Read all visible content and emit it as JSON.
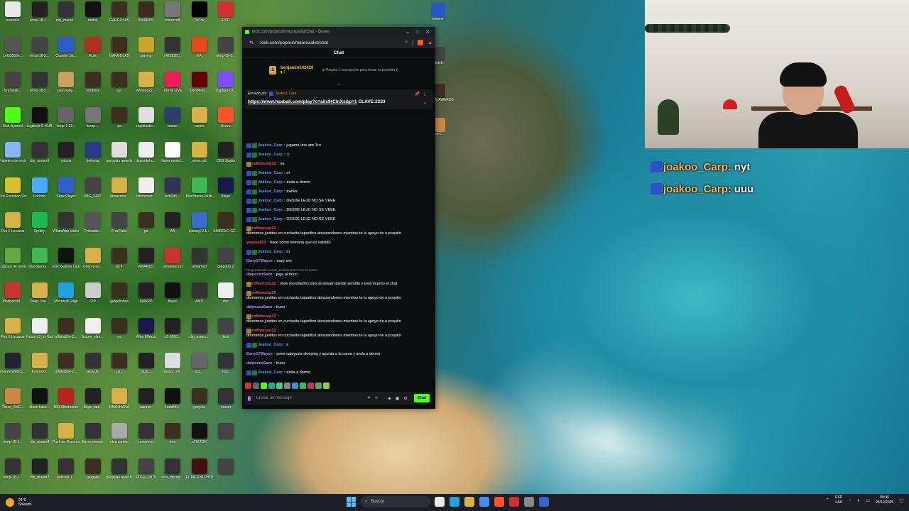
{
  "browser": {
    "title": "kick.com/popout/mauroxakd/chat - Brave",
    "url": "kick.com/popout/mauroxakd/chat"
  },
  "chat": {
    "header": "Chat",
    "gifter": {
      "name": "benjamin142420",
      "count": "1",
      "message": "Regala 1 suscripción para tomar la posición 2"
    },
    "pinned": {
      "label": "Enviado por",
      "user": "Joakoo_Carp",
      "link": "https://www.haxball.com/play?c=aiIx9rCInXs&p=1",
      "clave": "CLAVE:2233"
    },
    "messages": [
      {
        "user": "Joakoo_Carp",
        "text": "jugame uno ami 1ro",
        "color": "#4f9cff",
        "badges": [
          "#2d52c8",
          "#1f7a3a"
        ]
      },
      {
        "user": "Joakoo_Carp",
        "text": ":c",
        "color": "#4f9cff",
        "badges": [
          "#2d52c8",
          "#1f7a3a"
        ]
      },
      {
        "user": "rolfoncorp12",
        "text": "na",
        "color": "#ff4f6d",
        "badges": [
          "#a08a1f"
        ]
      },
      {
        "user": "Joakoo_Carp",
        "text": "nt",
        "color": "#4f9cff",
        "badges": [
          "#2d52c8",
          "#1f7a3a"
        ]
      },
      {
        "user": "Joakoo_Carp",
        "text": "anda a dormir",
        "color": "#4f9cff",
        "badges": [
          "#2d52c8",
          "#1f7a3a"
        ]
      },
      {
        "user": "Joakoo_Carp",
        "text": "tranka",
        "color": "#4f9cff",
        "badges": [
          "#2d52c8",
          "#1f7a3a"
        ]
      },
      {
        "user": "Joakoo_Carp",
        "text": "DESDE LEJO NO SE VEEE",
        "color": "#4f9cff",
        "badges": [
          "#2d52c8",
          "#1f7a3a"
        ]
      },
      {
        "user": "Joakoo_Carp",
        "text": "DESDE LEJO NO SE VEEE",
        "color": "#4f9cff",
        "badges": [
          "#2d52c8",
          "#1f7a3a"
        ]
      },
      {
        "user": "Joakoo_Carp",
        "text": "DESDE LEJO NO SE VEEE",
        "color": "#4f9cff",
        "badges": [
          "#2d52c8",
          "#1f7a3a"
        ]
      },
      {
        "user": "rolfoncorp12",
        "text": "dormimos juntitos en cucharita tapaditos abrazandonos mientras te la apoyo de a poquito",
        "color": "#ff4f6d",
        "badges": [
          "#a08a1f"
        ]
      },
      {
        "user": "yeyeyyll01",
        "text": "hace como     semana que es sabado",
        "color": "#ff4f6d",
        "badges": []
      },
      {
        "user": "Joakoo_Carp",
        "text": "nt",
        "color": "#4f9cff",
        "badges": [
          "#2d52c8",
          "#1f7a3a"
        ]
      },
      {
        "user": "Dany17Wayss",
        "text": "easy win",
        "color": "#b388ff",
        "badges": []
      },
      {
        "user": "dalpozzoSanz",
        "text": "juga al truco",
        "color": "#b388ff",
        "badges": [],
        "reply": "Respondiendo a God_studioCARP: hace el sorteo"
      },
      {
        "user": "rolfoncorp12",
        "text": "viste morcilla/hin bots el stream pierde sentido y está muerto el chat",
        "color": "#ff4f6d",
        "badges": [
          "#a08a1f"
        ]
      },
      {
        "user": "rolfoncorp12",
        "text": "dormimos juntitos en cucharita tapaditos abrazandonos mientras te la apoyo de a poquito",
        "color": "#ff4f6d",
        "badges": [
          "#a08a1f"
        ]
      },
      {
        "user": "dalpozzoSanz",
        "text": "truco",
        "color": "#b388ff",
        "badges": []
      },
      {
        "user": "rolfoncorp12",
        "text": "dormimos juntitos en cucharita tapaditos abrazandonos mientras te la apoyo de a poquito",
        "color": "#ff4f6d",
        "badges": [
          "#a08a1f"
        ]
      },
      {
        "user": "rolfoncorp12",
        "text": "dormimos juntitos en cucharita tapaditos abrazandonos mientras te la apoyo de a poquito",
        "color": "#ff4f6d",
        "badges": [
          "#a08a1f"
        ]
      },
      {
        "user": "Joakoo_Carp",
        "text": "e",
        "color": "#4f9cff",
        "badges": [
          "#2d52c8",
          "#1f7a3a"
        ]
      },
      {
        "user": "Dany17Wayss",
        "text": "pone categoria sleeping y apunta a la cama y anda a dormir",
        "color": "#b388ff",
        "badges": []
      },
      {
        "user": "dalpozzoSanz",
        "text": "truco",
        "color": "#b388ff",
        "badges": []
      },
      {
        "user": "Joakoo_Carp",
        "text": "anda a dormir",
        "color": "#4f9cff",
        "badges": [
          "#2d52c8",
          "#1f7a3a"
        ]
      },
      {
        "user": "Joakoo_Carp",
        "text": "nyt",
        "color": "#4f9cff",
        "badges": [
          "#2d52c8",
          "#1f7a3a"
        ]
      },
      {
        "user": "Joakoo_Carp",
        "text": "uuu",
        "color": "#4f9cff",
        "badges": [
          "#2d52c8",
          "#1f7a3a"
        ]
      }
    ],
    "input_placeholder": "Enviar un mensaje",
    "send_label": "Chat"
  },
  "overlay": [
    {
      "user": "joakoo_Carp",
      "text": "nyt"
    },
    {
      "user": "joakoo_Carp",
      "text": "uuu"
    }
  ],
  "desktop_icons": [
    {
      "label": "meneillu",
      "color": "#e8e8e8"
    },
    {
      "label": "temp-18-1...",
      "color": "#222"
    },
    {
      "label": "clip_mauro...",
      "color": "#333"
    },
    {
      "label": "roblox",
      "color": "#111"
    },
    {
      "label": "GARGOLAS",
      "color": "#3b3020"
    },
    {
      "label": "AWARDS",
      "color": "#3a2d1a"
    },
    {
      "label": "minecraft",
      "color": "#777"
    },
    {
      "label": "TikTok",
      "color": "#000"
    },
    {
      "label": "PDF",
      "color": "#d32f2f"
    },
    {
      "label": "Lef33556e...",
      "color": "#555"
    },
    {
      "label": "temp-18-2...",
      "color": "#444"
    },
    {
      "label": "Counter Str...",
      "color": "#2a5dc8"
    },
    {
      "label": "Rust",
      "color": "#b03020"
    },
    {
      "label": "GARGOLAS",
      "color": "#3b3020"
    },
    {
      "label": "playing",
      "color": "#c7a52a"
    },
    {
      "label": "c42181f2...",
      "color": "#333"
    },
    {
      "label": "EA",
      "color": "#e34a1a"
    },
    {
      "label": "temp-18-1...",
      "color": "#444"
    },
    {
      "label": "brickwall...",
      "color": "#444"
    },
    {
      "label": "temp-18-2...",
      "color": "#333"
    },
    {
      "label": "cute-baby...",
      "color": "#c8a060"
    },
    {
      "label": "simbolo",
      "color": "#3b3020"
    },
    {
      "label": "gs",
      "color": "#3b3020"
    },
    {
      "label": "ANSIed22...",
      "color": "#d8b04a"
    },
    {
      "label": "TikTok LIVE",
      "color": "#ee1d52"
    },
    {
      "label": "b97d4-95...",
      "color": "#600"
    },
    {
      "label": "Capture Of...",
      "color": "#7c4dff"
    },
    {
      "label": "Kick-Symbol",
      "color": "#53fc18"
    },
    {
      "label": "Logitech G HUB",
      "color": "#111"
    },
    {
      "label": "temp-7-23...",
      "color": "#666"
    },
    {
      "label": "temp...",
      "color": "#777"
    },
    {
      "label": "gs",
      "color": "#3b3020"
    },
    {
      "label": "rapidtastic...",
      "color": "#ddd"
    },
    {
      "label": "banco",
      "color": "#2b3f6b"
    },
    {
      "label": "carpin",
      "color": "#d8b04a"
    },
    {
      "label": "Brave",
      "color": "#fb542b"
    },
    {
      "label": "Papelera de reciclaje",
      "color": "#8ab4f8"
    },
    {
      "label": "clip_mauro0",
      "color": "#333"
    },
    {
      "label": "micros",
      "color": "#222"
    },
    {
      "label": "defensa",
      "color": "#2a3a8a"
    },
    {
      "label": "gargolas awards",
      "color": "#ddd"
    },
    {
      "label": "depositpho...",
      "color": "#eee"
    },
    {
      "label": "flayer model...",
      "color": "#fff"
    },
    {
      "label": "minecraft",
      "color": "#d8b04a"
    },
    {
      "label": "OBS Studio",
      "color": "#222"
    },
    {
      "label": "Pro Evolution Soccer 6",
      "color": "#d8c030"
    },
    {
      "label": "Fortnite",
      "color": "#4aa8ff"
    },
    {
      "label": "Xbox Player",
      "color": "#2f5fd0"
    },
    {
      "label": "IMG_2417",
      "color": "#444"
    },
    {
      "label": "Almacena...",
      "color": "#d8b04a"
    },
    {
      "label": "istockphot...",
      "color": "#eee"
    },
    {
      "label": "bcb2a5...",
      "color": "#335"
    },
    {
      "label": "BlueStacks Multi-Insta...",
      "color": "#3fb950"
    },
    {
      "label": "flayer",
      "color": "#1a1a4a"
    },
    {
      "label": "Pes 6 Locazos",
      "color": "#d8b04a"
    },
    {
      "label": "Spotify",
      "color": "#1db954"
    },
    {
      "label": "WhatsApp Video 20...",
      "color": "#333"
    },
    {
      "label": "Probable...",
      "color": "#555"
    },
    {
      "label": "FreeTube",
      "color": "#444"
    },
    {
      "label": "gs",
      "color": "#3b3020"
    },
    {
      "label": "AA",
      "color": "#222"
    },
    {
      "label": "upscayl-2.1...",
      "color": "#3a6bd0"
    },
    {
      "label": "SIMBOLO GE...",
      "color": "#3b3020"
    },
    {
      "label": "Captura de pantalla ...",
      "color": "#6a4"
    },
    {
      "label": "BlueStacks ...",
      "color": "#3fb950"
    },
    {
      "label": "Epic Games Launcher",
      "color": "#111"
    },
    {
      "label": "Deep-Live...",
      "color": "#d8b04a"
    },
    {
      "label": "gs 4",
      "color": "#3b3020"
    },
    {
      "label": "AWARDS",
      "color": "#222"
    },
    {
      "label": "unnamed (2)",
      "color": "#c33"
    },
    {
      "label": "unnamed",
      "color": "#333"
    },
    {
      "label": "gargolas 2",
      "color": "#444"
    },
    {
      "label": "ModpackM...",
      "color": "#c33"
    },
    {
      "label": "Deep-Live...",
      "color": "#d8b04a"
    },
    {
      "label": "Microsoft Edge",
      "color": "#1fa3e0"
    },
    {
      "label": "OIP",
      "color": "#ccc"
    },
    {
      "label": "gargolinhas",
      "color": "#3b3020"
    },
    {
      "label": "AWARD",
      "color": "#222"
    },
    {
      "label": "flayer",
      "color": "#111"
    },
    {
      "label": "AMD",
      "color": "#333"
    },
    {
      "label": "doc",
      "color": "#eee"
    },
    {
      "label": "Pes 6 Locazos",
      "color": "#d8b04a"
    },
    {
      "label": "Futsal x3_by Batinga Fre...",
      "color": "#eee"
    },
    {
      "label": "a9b6a56e-2...",
      "color": "#3b3020"
    },
    {
      "label": "fixture_elim...",
      "color": "#eee"
    },
    {
      "label": "gs",
      "color": "#3b3020"
    },
    {
      "label": "After Effects",
      "color": "#1a1a4a"
    },
    {
      "label": "v3-3858...",
      "color": "#222"
    },
    {
      "label": "clip_mauro...",
      "color": "#333"
    },
    {
      "label": "kick",
      "color": "#444"
    },
    {
      "label": "Nueva Webca...",
      "color": "#223"
    },
    {
      "label": "Extension",
      "color": "#d8b04a"
    },
    {
      "label": "a9b6a56e-2...",
      "color": "#3b3020"
    },
    {
      "label": "awards",
      "color": "#333"
    },
    {
      "label": "gs1",
      "color": "#3b3020"
    },
    {
      "label": "titulo...",
      "color": "#222"
    },
    {
      "label": "Galaxy_24...",
      "color": "#ddd"
    },
    {
      "label": "ac3...",
      "color": "#666"
    },
    {
      "label": "logo",
      "color": "#333"
    },
    {
      "label": "Tilnes_AME...",
      "color": "#c84"
    },
    {
      "label": "black-back...",
      "color": "#111"
    },
    {
      "label": "MSI Afterburner",
      "color": "#b22"
    },
    {
      "label": "flayer rad...",
      "color": "#222"
    },
    {
      "label": "HMOJHANA",
      "color": "#d8b04a"
    },
    {
      "label": "banner",
      "color": "#222"
    },
    {
      "label": "1adc8f0...",
      "color": "#111"
    },
    {
      "label": "gargola",
      "color": "#3b3020"
    },
    {
      "label": "mauro",
      "color": "#333"
    },
    {
      "label": "temp-18-1...",
      "color": "#444"
    },
    {
      "label": "clip_mauro0",
      "color": "#333"
    },
    {
      "label": "Pack de Recursos",
      "color": "#d8b04a"
    },
    {
      "label": "flayer stream",
      "color": "#333"
    },
    {
      "label": "idea cartele",
      "color": "#aaa"
    },
    {
      "label": "unnamed",
      "color": "#333"
    },
    {
      "label": "toro",
      "color": "#3b3020"
    },
    {
      "label": "nTIKTOK",
      "color": "#111"
    },
    {
      "label": "",
      "color": "#444"
    },
    {
      "label": "temp-18-1...",
      "color": "#333"
    },
    {
      "label": "clip_mauro2",
      "color": "#222"
    },
    {
      "label": "pelicula.1...",
      "color": "#333"
    },
    {
      "label": "gargola",
      "color": "#3b3020"
    },
    {
      "label": "gargolas awards",
      "color": "#333"
    },
    {
      "label": "EDGE_0075",
      "color": "#444"
    },
    {
      "label": "toro_vipcopi...",
      "color": "#333"
    },
    {
      "label": "EL MEJOR PHONK",
      "color": "#411"
    },
    {
      "label": "",
      "color": "#444"
    }
  ],
  "right_icons": [
    {
      "label": "banner",
      "color": "#2a55c8"
    },
    {
      "label": "Hnish",
      "color": "#444"
    },
    {
      "label": "RGOLAS AWARDS",
      "color": "#3b3020"
    },
    {
      "label": "3be-f...",
      "color": "#c84"
    }
  ],
  "taskbar": {
    "weather_temp": "24°C",
    "weather_desc": "Soleado",
    "search_label": "Buscar",
    "lang_top": "ESP",
    "lang_bottom": "LAA",
    "time": "08:36",
    "date": "28/12/2025",
    "apps": [
      "#e8e8e8",
      "#1fa3e0",
      "#d8b04a",
      "#4a8af0",
      "#fb542b",
      "#d32f2f",
      "#8a8a8a",
      "#36c"
    ]
  }
}
